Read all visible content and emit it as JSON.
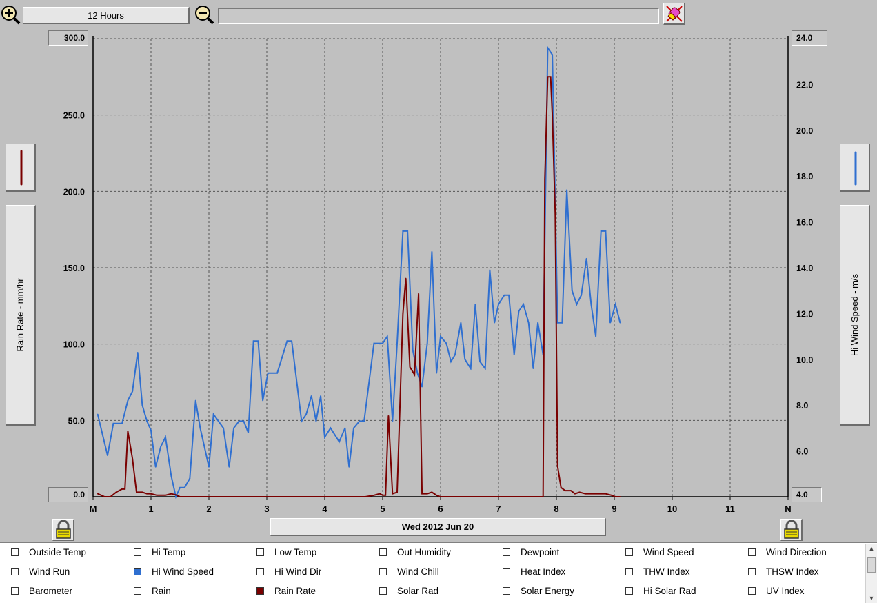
{
  "toolbar": {
    "zoom_in_icon": "zoom-in-icon",
    "zoom_out_icon": "zoom-out-icon",
    "span_label": "12 Hours",
    "status_text": "",
    "clear_icon": "eraser-icon"
  },
  "left_axis": {
    "label": "Rain Rate - mm/hr",
    "top_value": "300.0",
    "bottom_value": "0.0",
    "color": "#7a0000"
  },
  "right_axis": {
    "label": "Hi Wind Speed - m/s",
    "top_value": "24.0",
    "bottom_value": "4.0",
    "color": "#2f6fd0"
  },
  "date_label": "Wed 2012 Jun 20",
  "lock_icon": "padlock-icon",
  "legend": {
    "items": [
      {
        "label": "Outside Temp",
        "checked": false,
        "color": ""
      },
      {
        "label": "Hi Temp",
        "checked": false,
        "color": ""
      },
      {
        "label": "Low Temp",
        "checked": false,
        "color": ""
      },
      {
        "label": "Out Humidity",
        "checked": false,
        "color": ""
      },
      {
        "label": "Dewpoint",
        "checked": false,
        "color": ""
      },
      {
        "label": "Wind Speed",
        "checked": false,
        "color": ""
      },
      {
        "label": "Wind Direction",
        "checked": false,
        "color": ""
      },
      {
        "label": "Wind Run",
        "checked": false,
        "color": ""
      },
      {
        "label": "Hi Wind Speed",
        "checked": true,
        "color": "#2f6fd0"
      },
      {
        "label": "Hi Wind Dir",
        "checked": false,
        "color": ""
      },
      {
        "label": "Wind Chill",
        "checked": false,
        "color": ""
      },
      {
        "label": "Heat Index",
        "checked": false,
        "color": ""
      },
      {
        "label": "THW Index",
        "checked": false,
        "color": ""
      },
      {
        "label": "THSW Index",
        "checked": false,
        "color": ""
      },
      {
        "label": "Barometer",
        "checked": false,
        "color": ""
      },
      {
        "label": "Rain",
        "checked": false,
        "color": ""
      },
      {
        "label": "Rain Rate",
        "checked": true,
        "color": "#7a0000"
      },
      {
        "label": "Solar Rad",
        "checked": false,
        "color": ""
      },
      {
        "label": "Solar Energy",
        "checked": false,
        "color": ""
      },
      {
        "label": "Hi Solar Rad",
        "checked": false,
        "color": ""
      },
      {
        "label": "UV Index",
        "checked": false,
        "color": ""
      }
    ]
  },
  "chart_data": {
    "type": "line",
    "title": "",
    "xlabel": "Wed 2012 Jun 20",
    "x_ticks": [
      "M",
      "1",
      "2",
      "3",
      "4",
      "5",
      "6",
      "7",
      "8",
      "9",
      "10",
      "11",
      "N"
    ],
    "xlim": [
      0,
      12
    ],
    "grid": true,
    "left_axis": {
      "label": "Rain Rate - mm/hr",
      "ylim": [
        0,
        300
      ],
      "ticks": [
        "0.0",
        "50.0",
        "100.0",
        "150.0",
        "200.0",
        "250.0",
        "300.0"
      ]
    },
    "right_axis": {
      "label": "Hi Wind Speed - m/s",
      "ylim": [
        4,
        24
      ],
      "ticks": [
        "4.0",
        "6.0",
        "8.0",
        "10.0",
        "12.0",
        "14.0",
        "16.0",
        "18.0",
        "20.0",
        "22.0",
        "24.0"
      ]
    },
    "series": [
      {
        "name": "Hi Wind Speed",
        "axis": "right",
        "color": "#2f6fd0",
        "points": [
          [
            0.08,
            7.6
          ],
          [
            0.25,
            5.8
          ],
          [
            0.35,
            7.2
          ],
          [
            0.5,
            7.2
          ],
          [
            0.6,
            8.2
          ],
          [
            0.68,
            8.6
          ],
          [
            0.77,
            10.3
          ],
          [
            0.85,
            8.0
          ],
          [
            0.93,
            7.3
          ],
          [
            1.0,
            6.9
          ],
          [
            1.08,
            5.3
          ],
          [
            1.17,
            6.2
          ],
          [
            1.25,
            6.6
          ],
          [
            1.35,
            4.9
          ],
          [
            1.43,
            4.0
          ],
          [
            1.5,
            4.4
          ],
          [
            1.58,
            4.4
          ],
          [
            1.67,
            4.8
          ],
          [
            1.77,
            8.2
          ],
          [
            1.85,
            7.0
          ],
          [
            2.0,
            5.3
          ],
          [
            2.08,
            7.6
          ],
          [
            2.25,
            7.0
          ],
          [
            2.35,
            5.3
          ],
          [
            2.43,
            7.0
          ],
          [
            2.52,
            7.3
          ],
          [
            2.6,
            7.3
          ],
          [
            2.68,
            6.8
          ],
          [
            2.77,
            10.8
          ],
          [
            2.85,
            10.8
          ],
          [
            2.93,
            8.2
          ],
          [
            3.02,
            9.4
          ],
          [
            3.18,
            9.4
          ],
          [
            3.35,
            10.8
          ],
          [
            3.43,
            10.8
          ],
          [
            3.6,
            7.3
          ],
          [
            3.68,
            7.6
          ],
          [
            3.77,
            8.4
          ],
          [
            3.85,
            7.3
          ],
          [
            3.93,
            8.4
          ],
          [
            4.0,
            6.6
          ],
          [
            4.1,
            7.0
          ],
          [
            4.25,
            6.4
          ],
          [
            4.35,
            7.0
          ],
          [
            4.42,
            5.3
          ],
          [
            4.5,
            7.0
          ],
          [
            4.6,
            7.3
          ],
          [
            4.68,
            7.3
          ],
          [
            4.85,
            10.7
          ],
          [
            5.0,
            10.7
          ],
          [
            5.08,
            11.0
          ],
          [
            5.17,
            7.3
          ],
          [
            5.25,
            10.7
          ],
          [
            5.35,
            15.6
          ],
          [
            5.43,
            15.6
          ],
          [
            5.52,
            10.4
          ],
          [
            5.6,
            9.4
          ],
          [
            5.68,
            8.8
          ],
          [
            5.77,
            10.7
          ],
          [
            5.85,
            14.7
          ],
          [
            5.93,
            9.4
          ],
          [
            6.0,
            11.0
          ],
          [
            6.1,
            10.7
          ],
          [
            6.18,
            9.9
          ],
          [
            6.25,
            10.2
          ],
          [
            6.35,
            11.6
          ],
          [
            6.42,
            10.0
          ],
          [
            6.52,
            9.6
          ],
          [
            6.6,
            12.4
          ],
          [
            6.68,
            9.9
          ],
          [
            6.77,
            9.6
          ],
          [
            6.85,
            13.9
          ],
          [
            6.93,
            11.6
          ],
          [
            7.0,
            12.4
          ],
          [
            7.1,
            12.8
          ],
          [
            7.18,
            12.8
          ],
          [
            7.27,
            10.2
          ],
          [
            7.35,
            12.1
          ],
          [
            7.43,
            12.4
          ],
          [
            7.52,
            11.6
          ],
          [
            7.6,
            9.6
          ],
          [
            7.68,
            11.6
          ],
          [
            7.77,
            10.2
          ],
          [
            7.85,
            23.6
          ],
          [
            7.93,
            23.3
          ],
          [
            8.02,
            11.6
          ],
          [
            8.1,
            11.6
          ],
          [
            8.18,
            17.4
          ],
          [
            8.27,
            13.0
          ],
          [
            8.35,
            12.4
          ],
          [
            8.43,
            12.8
          ],
          [
            8.52,
            14.4
          ],
          [
            8.6,
            12.4
          ],
          [
            8.68,
            11.0
          ],
          [
            8.77,
            15.6
          ],
          [
            8.85,
            15.6
          ],
          [
            8.93,
            11.6
          ],
          [
            9.02,
            12.4
          ],
          [
            9.1,
            11.6
          ]
        ]
      },
      {
        "name": "Rain Rate",
        "axis": "left",
        "color": "#7a0000",
        "points": [
          [
            0.08,
            2
          ],
          [
            0.2,
            0
          ],
          [
            0.3,
            0
          ],
          [
            0.4,
            3
          ],
          [
            0.5,
            5
          ],
          [
            0.55,
            5
          ],
          [
            0.6,
            43
          ],
          [
            0.68,
            25
          ],
          [
            0.75,
            3
          ],
          [
            0.85,
            3
          ],
          [
            0.93,
            2
          ],
          [
            1.0,
            2
          ],
          [
            1.1,
            1
          ],
          [
            1.25,
            1
          ],
          [
            1.35,
            2
          ],
          [
            1.45,
            1
          ],
          [
            1.5,
            0
          ],
          [
            2.0,
            0
          ],
          [
            3.0,
            0
          ],
          [
            4.0,
            0
          ],
          [
            4.7,
            0
          ],
          [
            4.85,
            1
          ],
          [
            4.95,
            2
          ],
          [
            5.0,
            1
          ],
          [
            5.05,
            1
          ],
          [
            5.1,
            53
          ],
          [
            5.17,
            2
          ],
          [
            5.25,
            3
          ],
          [
            5.35,
            120
          ],
          [
            5.4,
            143
          ],
          [
            5.47,
            85
          ],
          [
            5.55,
            80
          ],
          [
            5.62,
            133
          ],
          [
            5.68,
            2
          ],
          [
            5.77,
            2
          ],
          [
            5.85,
            3
          ],
          [
            5.93,
            1
          ],
          [
            6.0,
            0
          ],
          [
            6.5,
            0
          ],
          [
            7.0,
            0
          ],
          [
            7.5,
            0
          ],
          [
            7.77,
            0
          ],
          [
            7.8,
            208
          ],
          [
            7.85,
            275
          ],
          [
            7.9,
            275
          ],
          [
            7.93,
            250
          ],
          [
            7.98,
            185
          ],
          [
            8.02,
            20
          ],
          [
            8.08,
            6
          ],
          [
            8.15,
            4
          ],
          [
            8.25,
            4
          ],
          [
            8.32,
            2
          ],
          [
            8.4,
            3
          ],
          [
            8.5,
            2
          ],
          [
            8.6,
            2
          ],
          [
            8.77,
            2
          ],
          [
            8.85,
            2
          ],
          [
            8.95,
            1
          ],
          [
            9.02,
            0
          ],
          [
            9.1,
            0
          ]
        ]
      }
    ]
  }
}
